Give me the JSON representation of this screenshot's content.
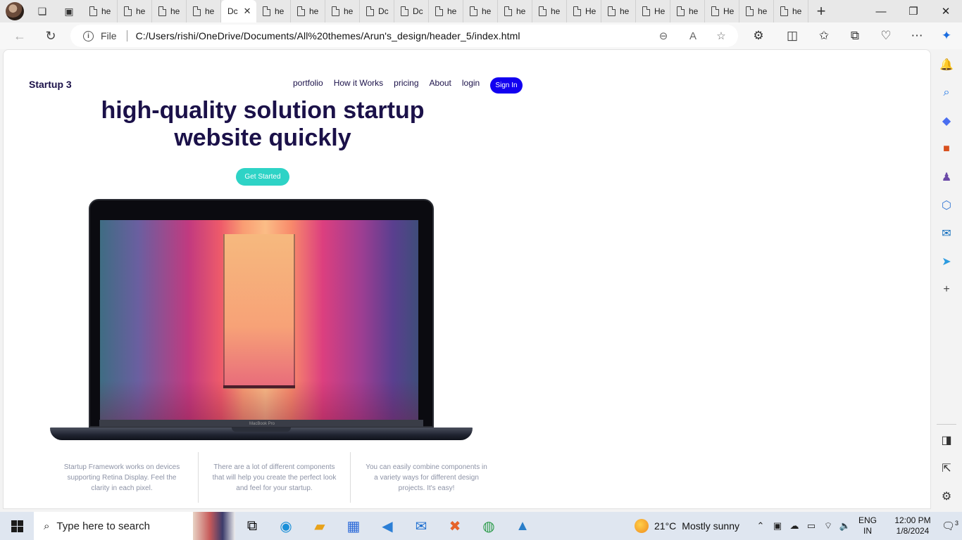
{
  "browser": {
    "tabs": [
      {
        "label": "he"
      },
      {
        "label": "he"
      },
      {
        "label": "he"
      },
      {
        "label": "he"
      },
      {
        "label": "Dc",
        "active": true
      },
      {
        "label": "he"
      },
      {
        "label": "he"
      },
      {
        "label": "he"
      },
      {
        "label": "Dc"
      },
      {
        "label": "Dc"
      },
      {
        "label": "he"
      },
      {
        "label": "he"
      },
      {
        "label": "he"
      },
      {
        "label": "he"
      },
      {
        "label": "He"
      },
      {
        "label": "he"
      },
      {
        "label": "He"
      },
      {
        "label": "he"
      },
      {
        "label": "He"
      },
      {
        "label": "he"
      },
      {
        "label": "he"
      }
    ],
    "address": {
      "scheme_label": "File",
      "url": "C:/Users/rishi/OneDrive/Documents/All%20themes/Arun's_design/header_5/index.html"
    }
  },
  "site": {
    "logo": "Startup 3",
    "nav": {
      "portfolio": "portfolio",
      "how": "How it Works",
      "pricing": "pricing",
      "about": "About",
      "login": "login"
    },
    "signin": "Sign In",
    "hero": {
      "title": "high-quality solution startup website quickly",
      "cta": "Get Started"
    },
    "laptop_model": "MacBook Pro",
    "features": [
      "Startup Framework works on devices supporting Retina Display. Feel the clarity in each pixel.",
      "There are a lot of different components that will help you create the perfect look and feel for your startup.",
      "You can easily combine components in a variety ways for different design projects. It's easy!"
    ],
    "colors": {
      "heading": "#1b1149",
      "signin": "#1200f0",
      "cta": "#2ed3c6",
      "feature_text": "#8d93a6"
    }
  },
  "taskbar": {
    "search_placeholder": "Type here to search",
    "weather": {
      "temp": "21°C",
      "condition": "Mostly sunny"
    },
    "language": {
      "line1": "ENG",
      "line2": "IN"
    },
    "clock": {
      "time": "12:00 PM",
      "date": "1/8/2024"
    },
    "notification_count": "3"
  }
}
